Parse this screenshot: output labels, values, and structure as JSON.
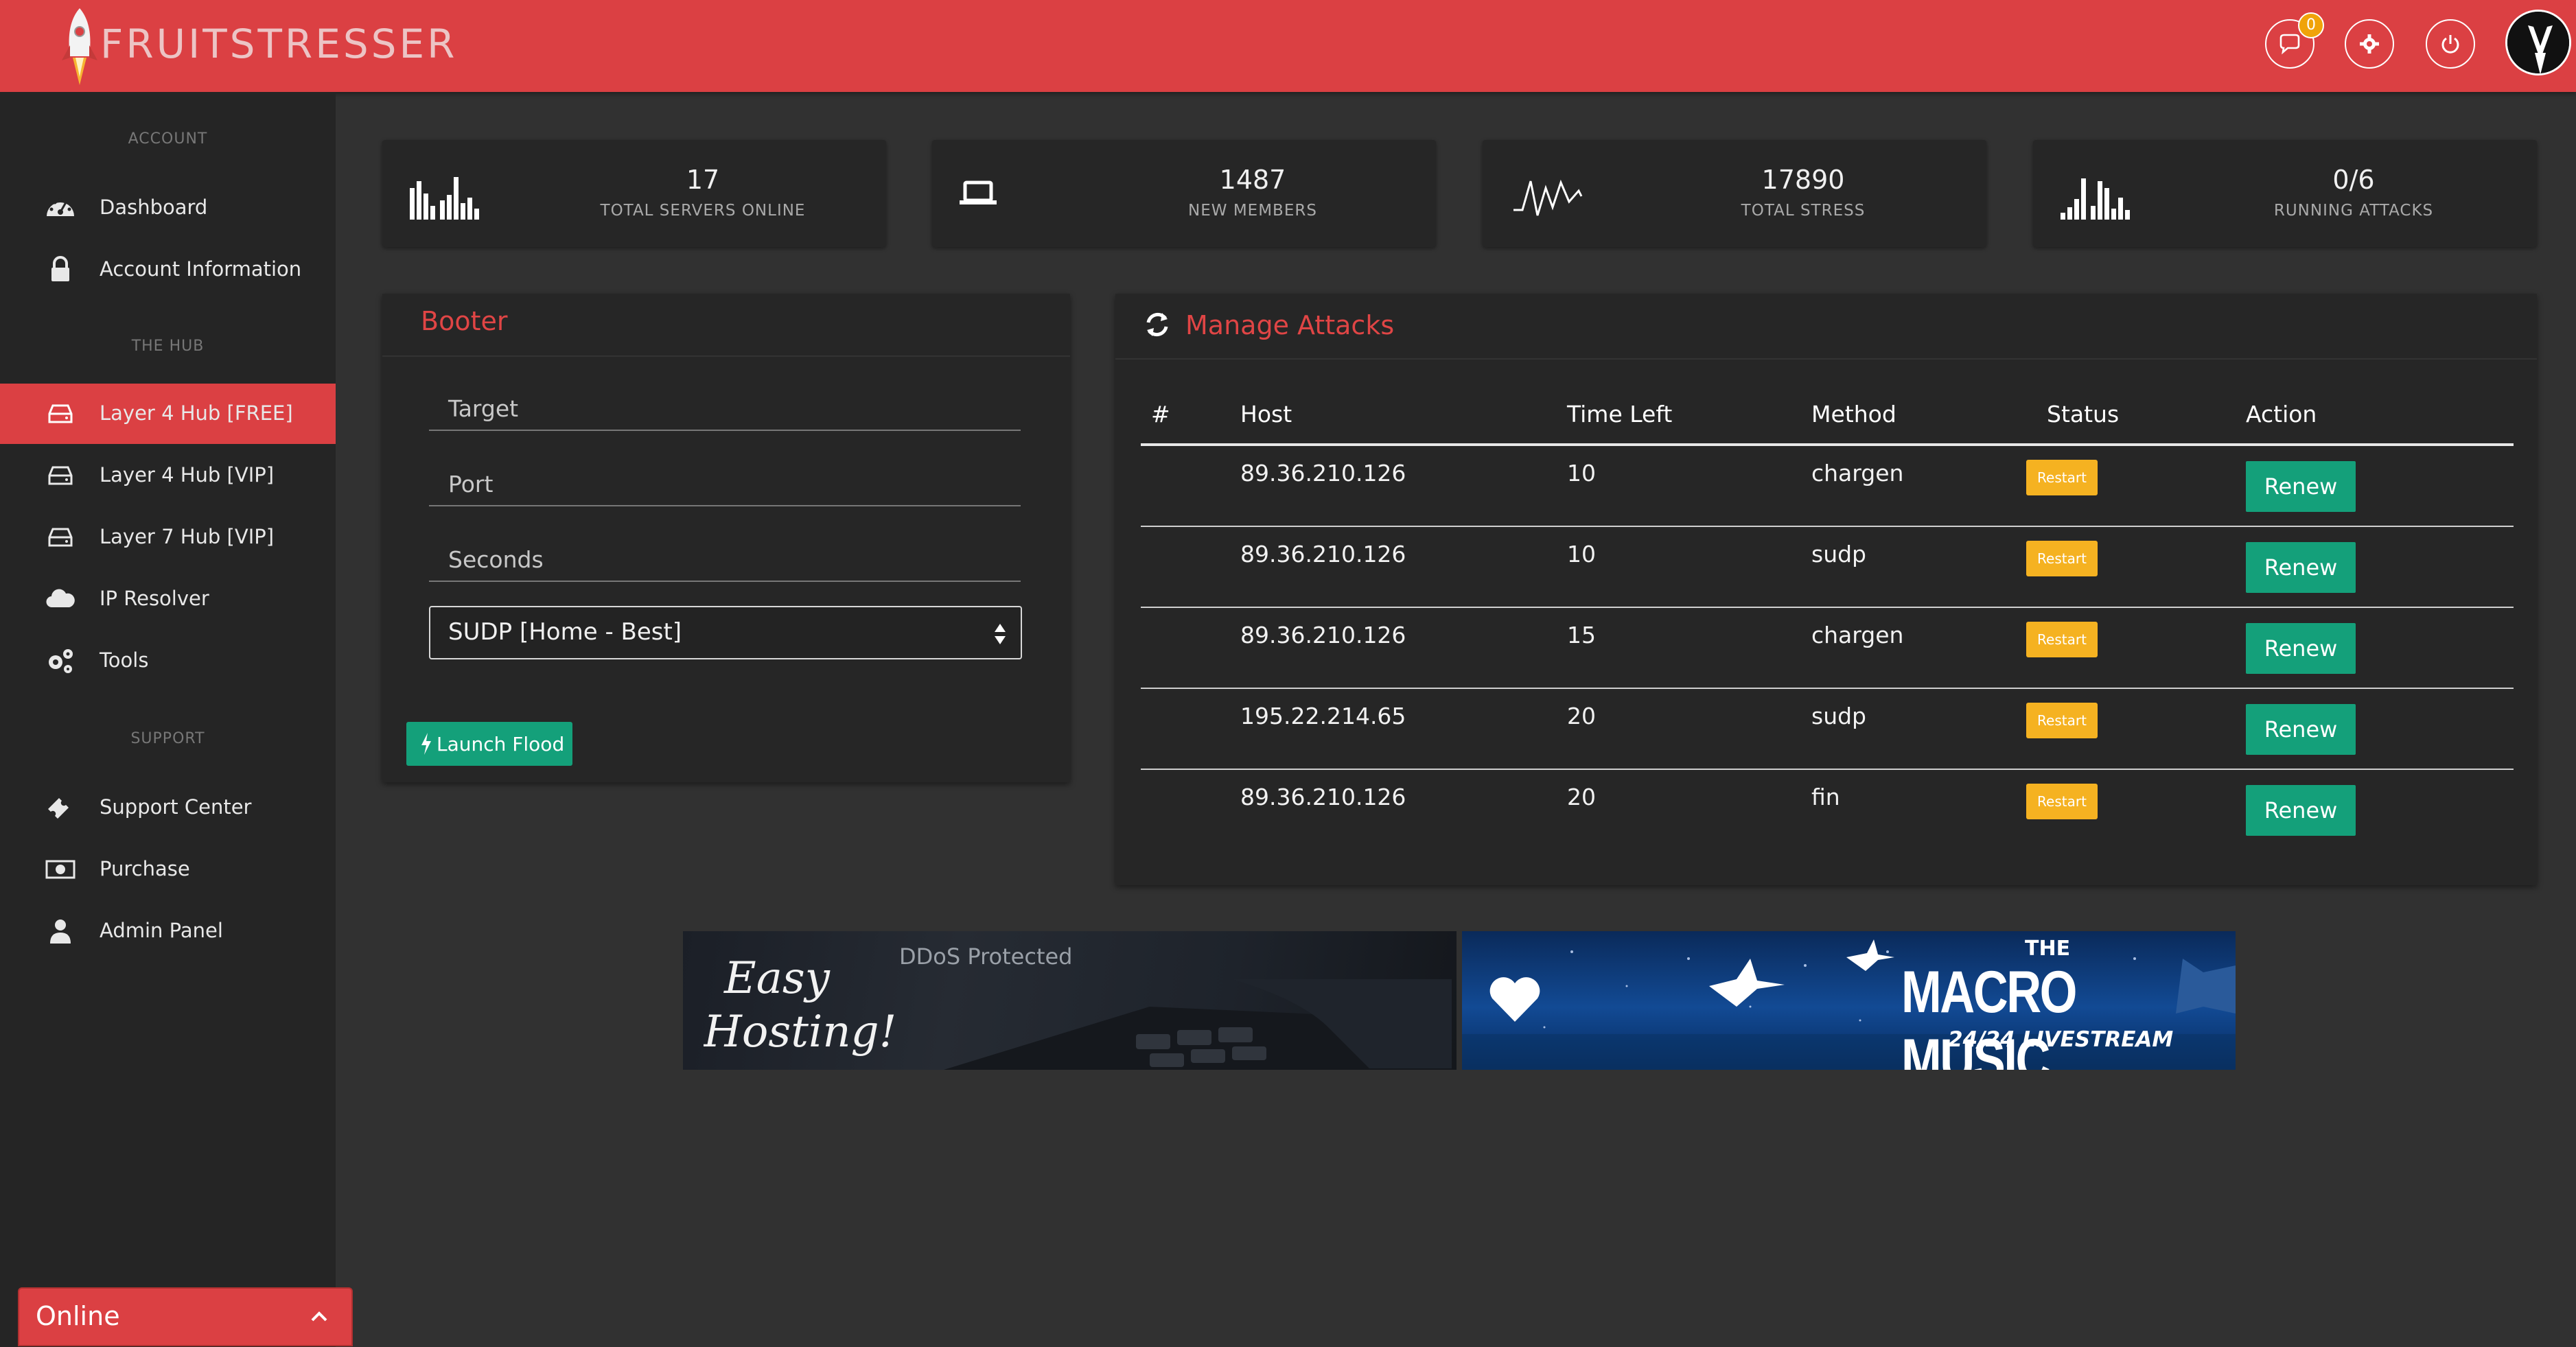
{
  "header": {
    "brand": "FRUITSTRESSER",
    "chat_badge_count": "0",
    "icons": [
      "rocket-icon",
      "chat-icon",
      "gear-icon",
      "power-icon",
      "avatar"
    ],
    "accent_color": "#db4043"
  },
  "sidebar": {
    "sections": {
      "account": "ACCOUNT",
      "hub": "THE HUB",
      "support": "SUPPORT"
    },
    "items": [
      {
        "label": "Dashboard",
        "icon": "dashboard-icon"
      },
      {
        "label": "Account Information",
        "icon": "lock-icon"
      },
      {
        "label": "Layer 4 Hub [FREE]",
        "icon": "hdd-icon",
        "active": true
      },
      {
        "label": "Layer 4 Hub [VIP]",
        "icon": "hdd-icon"
      },
      {
        "label": "Layer 7 Hub [VIP]",
        "icon": "hdd-icon"
      },
      {
        "label": "IP Resolver",
        "icon": "cloud-icon"
      },
      {
        "label": "Tools",
        "icon": "gears-icon"
      },
      {
        "label": "Support Center",
        "icon": "ticket-icon"
      },
      {
        "label": "Purchase",
        "icon": "money-icon"
      },
      {
        "label": "Admin Panel",
        "icon": "user-icon"
      }
    ],
    "status": "Online"
  },
  "stats": [
    {
      "value": "17",
      "caption": "TOTAL SERVERS ONLINE",
      "icon": "bar-chart-icon"
    },
    {
      "value": "1487",
      "caption": "NEW MEMBERS",
      "icon": "laptop-icon"
    },
    {
      "value": "17890",
      "caption": "TOTAL STRESS",
      "icon": "pulse-icon"
    },
    {
      "value": "0/6",
      "caption": "RUNNING ATTACKS",
      "icon": "bar-chart-icon"
    }
  ],
  "booter": {
    "title": "Booter",
    "target_placeholder": "Target",
    "port_placeholder": "Port",
    "seconds_placeholder": "Seconds",
    "method_selected": "SUDP [Home - Best]",
    "launch_label": "Launch Flood"
  },
  "manage": {
    "title": "Manage Attacks",
    "headers": [
      "#",
      "Host",
      "Time Left",
      "Method",
      "Status",
      "Action"
    ],
    "restart_label": "Restart",
    "renew_label": "Renew",
    "rows": [
      {
        "num": "",
        "host": "89.36.210.126",
        "time_left": "10",
        "method": "chargen"
      },
      {
        "num": "",
        "host": "89.36.210.126",
        "time_left": "10",
        "method": "sudp"
      },
      {
        "num": "",
        "host": "89.36.210.126",
        "time_left": "15",
        "method": "chargen"
      },
      {
        "num": "",
        "host": "195.22.214.65",
        "time_left": "20",
        "method": "sudp"
      },
      {
        "num": "",
        "host": "89.36.210.126",
        "time_left": "20",
        "method": "fin"
      }
    ]
  },
  "banners": {
    "left": {
      "script_line1": "Easy",
      "script_line2": "Hosting!",
      "tagline": "DDoS Protected"
    },
    "right": {
      "the": "THE",
      "name": "MACRO MUSIC",
      "subtitle": "24/24 LIVESTREAM"
    }
  }
}
